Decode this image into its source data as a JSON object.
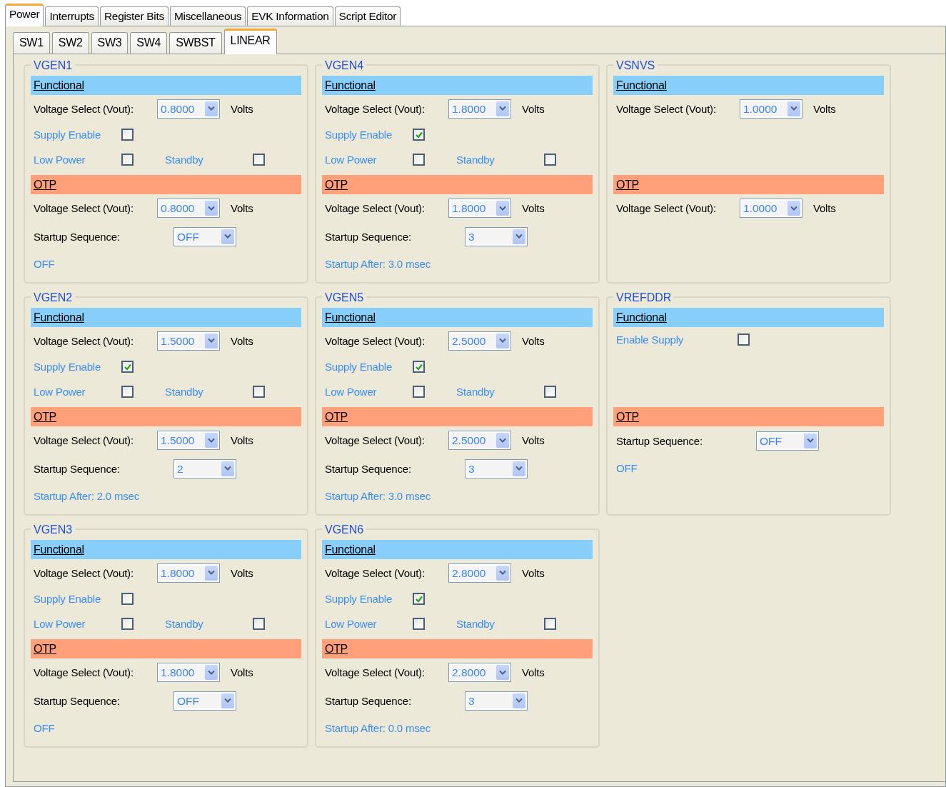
{
  "tabs": [
    {
      "label": "Power",
      "selected": true
    },
    {
      "label": "Interrupts",
      "selected": false
    },
    {
      "label": "Register Bits",
      "selected": false
    },
    {
      "label": "Miscellaneous",
      "selected": false
    },
    {
      "label": "EVK Information",
      "selected": false
    },
    {
      "label": "Script Editor",
      "selected": false
    }
  ],
  "subtabs": [
    {
      "label": "SW1",
      "selected": false
    },
    {
      "label": "SW2",
      "selected": false
    },
    {
      "label": "SW3",
      "selected": false
    },
    {
      "label": "SW4",
      "selected": false
    },
    {
      "label": "SWBST",
      "selected": false
    },
    {
      "label": "LINEAR",
      "selected": true
    }
  ],
  "panels": [
    {
      "title": "VGEN1",
      "functional": {
        "header": "Functional",
        "rows": [
          {
            "kind": "voltage",
            "label": "Voltage Select (Vout):",
            "value": "0.8000",
            "unit": "Volts"
          },
          {
            "kind": "checks",
            "items": [
              {
                "label": "Supply Enable",
                "checked": false
              }
            ]
          },
          {
            "kind": "checks",
            "items": [
              {
                "label": "Low Power",
                "checked": false
              },
              {
                "label": "Standby",
                "checked": false
              }
            ]
          }
        ]
      },
      "otp": {
        "header": "OTP",
        "rows": [
          {
            "kind": "voltage",
            "label": "Voltage Select (Vout):",
            "value": "0.8000",
            "unit": "Volts"
          },
          {
            "kind": "sequence",
            "label": "Startup Sequence:",
            "value": "OFF"
          },
          {
            "kind": "status",
            "text": "OFF"
          }
        ]
      }
    },
    {
      "title": "VGEN4",
      "functional": {
        "header": "Functional",
        "rows": [
          {
            "kind": "voltage",
            "label": "Voltage Select (Vout):",
            "value": "1.8000",
            "unit": "Volts"
          },
          {
            "kind": "checks",
            "items": [
              {
                "label": "Supply Enable",
                "checked": true
              }
            ]
          },
          {
            "kind": "checks",
            "items": [
              {
                "label": "Low Power",
                "checked": false
              },
              {
                "label": "Standby",
                "checked": false
              }
            ]
          }
        ]
      },
      "otp": {
        "header": "OTP",
        "rows": [
          {
            "kind": "voltage",
            "label": "Voltage Select (Vout):",
            "value": "1.8000",
            "unit": "Volts"
          },
          {
            "kind": "sequence",
            "label": "Startup Sequence:",
            "value": "3"
          },
          {
            "kind": "status",
            "text": "Startup After: 3.0 msec"
          }
        ]
      }
    },
    {
      "title": "VSNVS",
      "functional": {
        "header": "Functional",
        "rows": [
          {
            "kind": "voltage",
            "label": "Voltage Select (Vout):",
            "value": "1.0000",
            "unit": "Volts"
          }
        ]
      },
      "otp": {
        "header": "OTP",
        "rows": [
          {
            "kind": "voltage",
            "label": "Voltage Select (Vout):",
            "value": "1.0000",
            "unit": "Volts"
          }
        ]
      }
    },
    {
      "title": "VGEN2",
      "functional": {
        "header": "Functional",
        "rows": [
          {
            "kind": "voltage",
            "label": "Voltage Select (Vout):",
            "value": "1.5000",
            "unit": "Volts"
          },
          {
            "kind": "checks",
            "items": [
              {
                "label": "Supply Enable",
                "checked": true
              }
            ]
          },
          {
            "kind": "checks",
            "items": [
              {
                "label": "Low Power",
                "checked": false
              },
              {
                "label": "Standby",
                "checked": false
              }
            ]
          }
        ]
      },
      "otp": {
        "header": "OTP",
        "rows": [
          {
            "kind": "voltage",
            "label": "Voltage Select (Vout):",
            "value": "1.5000",
            "unit": "Volts"
          },
          {
            "kind": "sequence",
            "label": "Startup Sequence:",
            "value": "2"
          },
          {
            "kind": "status",
            "text": "Startup After: 2.0 msec"
          }
        ]
      }
    },
    {
      "title": "VGEN5",
      "functional": {
        "header": "Functional",
        "rows": [
          {
            "kind": "voltage",
            "label": "Voltage Select (Vout):",
            "value": "2.5000",
            "unit": "Volts"
          },
          {
            "kind": "checks",
            "items": [
              {
                "label": "Supply Enable",
                "checked": true
              }
            ]
          },
          {
            "kind": "checks",
            "items": [
              {
                "label": "Low Power",
                "checked": false
              },
              {
                "label": "Standby",
                "checked": false
              }
            ]
          }
        ]
      },
      "otp": {
        "header": "OTP",
        "rows": [
          {
            "kind": "voltage",
            "label": "Voltage Select (Vout):",
            "value": "2.5000",
            "unit": "Volts"
          },
          {
            "kind": "sequence",
            "label": "Startup Sequence:",
            "value": "3"
          },
          {
            "kind": "status",
            "text": "Startup After: 3.0 msec"
          }
        ]
      }
    },
    {
      "title": "VREFDDR",
      "functional": {
        "header": "Functional",
        "rows": [
          {
            "kind": "wide_check",
            "items": [
              {
                "label": "Enable Supply",
                "checked": false
              }
            ]
          }
        ]
      },
      "otp": {
        "header": "OTP",
        "rows": [
          {
            "kind": "sequence",
            "label": "Startup Sequence:",
            "value": "OFF"
          },
          {
            "kind": "status",
            "text": "OFF"
          }
        ]
      }
    },
    {
      "title": "VGEN3",
      "functional": {
        "header": "Functional",
        "rows": [
          {
            "kind": "voltage",
            "label": "Voltage Select (Vout):",
            "value": "1.8000",
            "unit": "Volts"
          },
          {
            "kind": "checks",
            "items": [
              {
                "label": "Supply Enable",
                "checked": false
              }
            ]
          },
          {
            "kind": "checks",
            "items": [
              {
                "label": "Low Power",
                "checked": false
              },
              {
                "label": "Standby",
                "checked": false
              }
            ]
          }
        ]
      },
      "otp": {
        "header": "OTP",
        "rows": [
          {
            "kind": "voltage",
            "label": "Voltage Select (Vout):",
            "value": "1.8000",
            "unit": "Volts"
          },
          {
            "kind": "sequence",
            "label": "Startup Sequence:",
            "value": "OFF"
          },
          {
            "kind": "status",
            "text": "OFF"
          }
        ]
      }
    },
    {
      "title": "VGEN6",
      "functional": {
        "header": "Functional",
        "rows": [
          {
            "kind": "voltage",
            "label": "Voltage Select (Vout):",
            "value": "2.8000",
            "unit": "Volts"
          },
          {
            "kind": "checks",
            "items": [
              {
                "label": "Supply Enable",
                "checked": true
              }
            ]
          },
          {
            "kind": "checks",
            "items": [
              {
                "label": "Low Power",
                "checked": false
              },
              {
                "label": "Standby",
                "checked": false
              }
            ]
          }
        ]
      },
      "otp": {
        "header": "OTP",
        "rows": [
          {
            "kind": "voltage",
            "label": "Voltage Select (Vout):",
            "value": "2.8000",
            "unit": "Volts"
          },
          {
            "kind": "sequence",
            "label": "Startup Sequence:",
            "value": "3"
          },
          {
            "kind": "status",
            "text": "Startup After: 0.0 msec"
          }
        ]
      }
    }
  ]
}
